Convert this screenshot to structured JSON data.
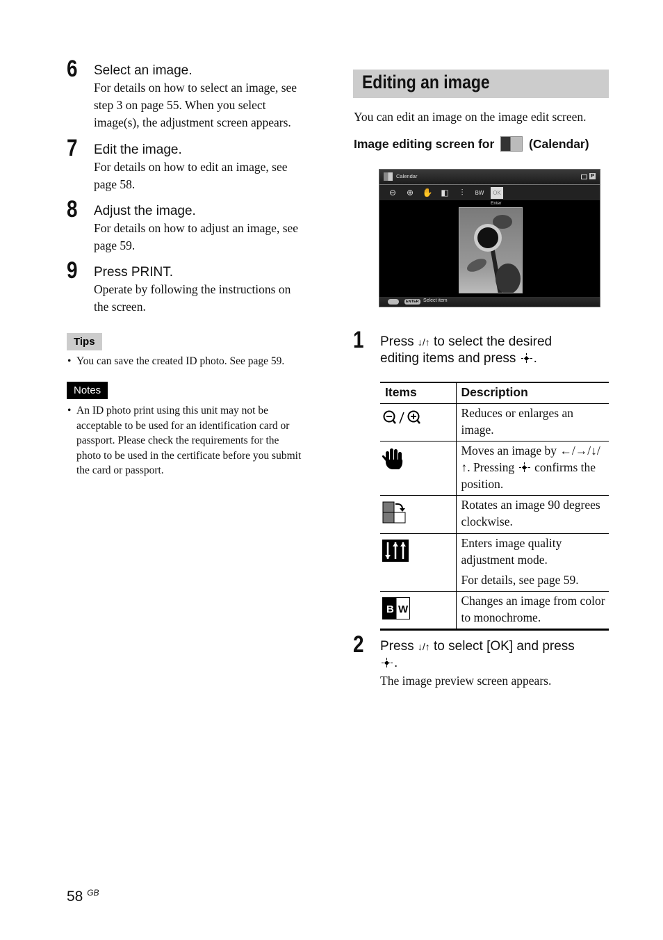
{
  "left_steps": [
    {
      "num": "6",
      "title": "Select an image.",
      "body": [
        "For details on how to select an image, see",
        "step 3 on page 55. When you select",
        "image(s), the adjustment screen appears."
      ]
    },
    {
      "num": "7",
      "title": "Edit the image.",
      "body": [
        "For details on how to edit an image, see",
        "page 58."
      ]
    },
    {
      "num": "8",
      "title": "Adjust the image.",
      "body": [
        "For details on how to adjust an image, see",
        "page 59."
      ]
    },
    {
      "num": "9",
      "title": "Press PRINT.",
      "body": [
        "Operate by following the instructions on",
        "the screen."
      ]
    }
  ],
  "tips": {
    "label": "Tips",
    "items": [
      "You can save the created ID photo. See page 59."
    ]
  },
  "notes": {
    "label": "Notes",
    "items": [
      [
        "An ID photo print using this unit may not be",
        "acceptable to be used for an identification card or",
        "passport. Please check the requirements for the",
        "photo to be used in the certificate before you submit",
        "the card or passport."
      ]
    ]
  },
  "section": {
    "title": "Editing an image",
    "intro": "You can edit an image on the image edit screen.",
    "subhead_prefix": "Image editing screen for",
    "subhead_suffix": "(Calendar)"
  },
  "screen": {
    "title": "Calendar",
    "toolbar_icons": [
      "zoom-out",
      "zoom-in",
      "hand",
      "rotate",
      "adjust",
      "bw",
      "enter"
    ],
    "enter_label": "Enter",
    "footer_key": "ENTER",
    "footer_text": "Select item"
  },
  "steps_right": [
    {
      "num": "1",
      "line1_a": "Press ",
      "arrows": "↓/↑",
      "line1_b": " to select the desired",
      "line2": "editing items and press"
    },
    {
      "num": "2",
      "line1_a": "Press ",
      "arrows": "↓/↑",
      "line1_b": " to select [OK] and press",
      "body": "The image preview screen appears."
    }
  ],
  "table": {
    "headers": [
      "Items",
      "Description"
    ],
    "rows": [
      {
        "icon": "zoom-out-zoom-in",
        "desc": [
          "Reduces or enlarges an image."
        ]
      },
      {
        "icon": "hand",
        "desc_a": "Moves an image by ←/→/↓/",
        "desc_b": "↑. Pressing",
        "desc_c": "confirms the position."
      },
      {
        "icon": "rotate",
        "desc": [
          "Rotates an image 90 degrees clockwise."
        ]
      },
      {
        "icon": "image-quality-adjust",
        "desc": [
          "Enters image quality adjustment mode.",
          "For details, see page 59."
        ]
      },
      {
        "icon": "black-white",
        "desc": [
          "Changes an image from color to monochrome."
        ]
      }
    ]
  },
  "footer": {
    "page": "58",
    "region": "GB"
  }
}
